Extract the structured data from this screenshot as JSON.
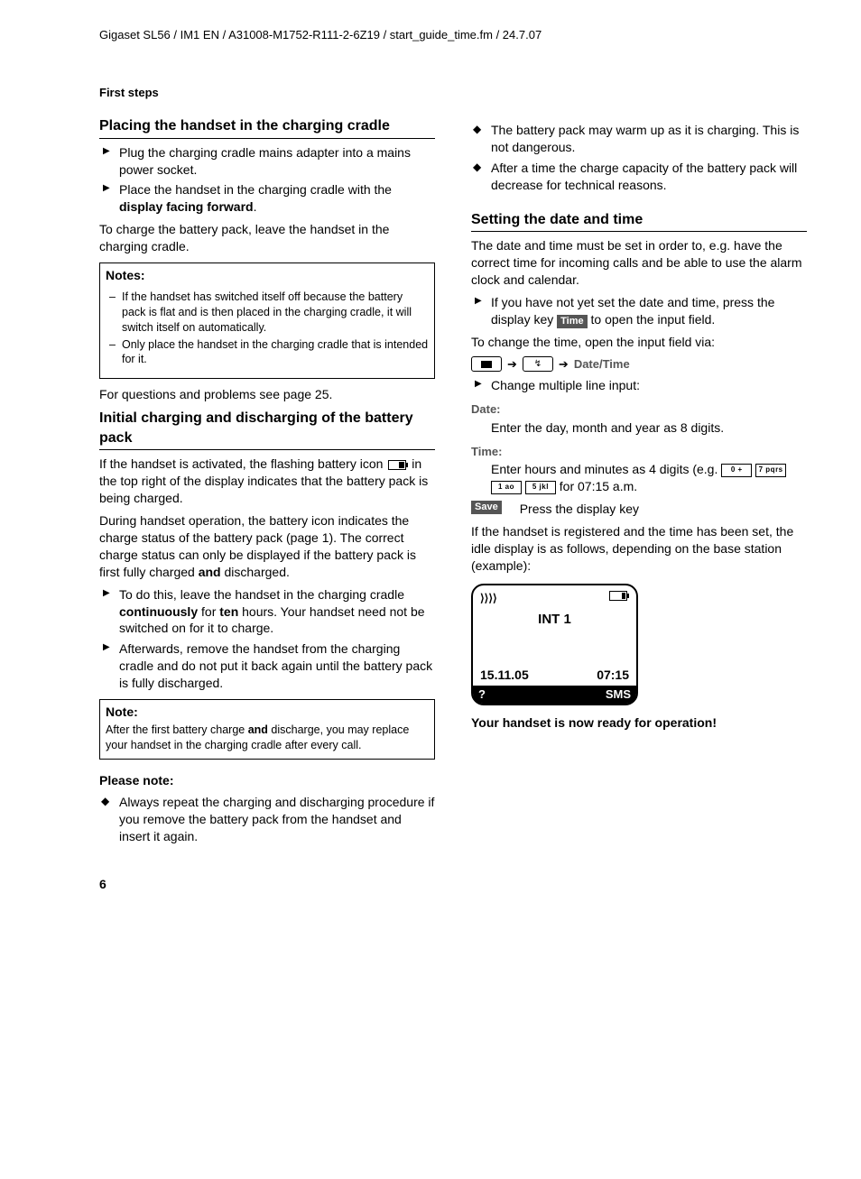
{
  "header_path": "Gigaset SL56 / IM1 EN / A31008-M1752-R111-2-6Z19 / start_guide_time.fm / 24.7.07",
  "section_label": "First steps",
  "page_number": "6",
  "left": {
    "h_placing": "Placing the handset in the charging cradle",
    "placing_items": [
      "Plug the charging cradle mains adapter into a mains power socket.",
      "Place the handset in the charging cradle with the "
    ],
    "placing_item2_bold": "display facing forward",
    "placing_item2_tail": ".",
    "charge_para": "To charge the battery pack, leave the handset in the charging cradle.",
    "notes_title": "Notes:",
    "notes_items": [
      "If the handset has switched itself off because the battery pack is flat and is then placed in the charging cradle, it will switch itself on automatically.",
      "Only place the handset in the charging cradle that is intended for it."
    ],
    "questions": "For questions and problems see page 25.",
    "h_initial": "Initial charging and discharging of the battery pack",
    "init_p1a": "If the handset is activated, the flashing battery icon ",
    "init_p1b": " in the top right of the display indicates that the battery pack is being charged.",
    "init_p2a": "During handset operation, the battery icon indicates the charge status of the battery pack (page 1). The correct charge status can only be displayed if the battery pack is first fully charged ",
    "init_p2_bold": "and",
    "init_p2b": " discharged.",
    "init_li1a": "To do this, leave the handset in the charging cradle ",
    "init_li1_b1": "continuously",
    "init_li1_mid": " for ",
    "init_li1_b2": "ten",
    "init_li1b": " hours. Your handset need not be switched on for it to charge.",
    "init_li2": "Afterwards, remove the handset from the charging cradle and do not put it back again until the battery pack is fully discharged.",
    "note2_title": "Note:",
    "note2_a": "After the first battery charge ",
    "note2_bold": "and",
    "note2_b": " discharge, you may replace your handset in the charging cradle after every call.",
    "please_note": "Please note:",
    "please_items": [
      "Always repeat the charging and discharging procedure if you remove the battery pack from the handset and insert it again."
    ]
  },
  "right": {
    "top_items": [
      "The battery pack may warm up as it is charging. This is not dangerous.",
      "After a time the charge capacity of the battery pack will decrease for technical reasons."
    ],
    "h_setting": "Setting the date and time",
    "set_p1": "The date and time must be set in order to, e.g. have the correct time for incoming calls and be able to use the alarm clock and calendar.",
    "set_li1a": "If you have not yet set the date and time, press the display key ",
    "time_key": "Time",
    "set_li1b": " to open the input field.",
    "set_p2": "To change the time, open the input field via:",
    "breadcrumb_end": "Date/Time",
    "change_li": "Change multiple line input:",
    "date_label": "Date:",
    "date_desc": "Enter the day, month and year as 8 digits.",
    "time_label": "Time:",
    "time_desc_a": "Enter hours and minutes as 4 digits (e.g. ",
    "keycaps": [
      "0 +",
      "7 pqrs",
      "1 ao",
      "5 jkl"
    ],
    "time_desc_b": " for 07:15 a.m.",
    "save_key": "Save",
    "save_desc": "Press the display key",
    "after_p": "If the handset is registered and the time has been set, the idle display is as follows, depending on the base station (example):",
    "screen": {
      "signal": "⟩⟩⟩⟩",
      "title": "INT 1",
      "date": "15.11.05",
      "time": "07:15",
      "soft_left": "?",
      "soft_right": "SMS"
    },
    "ready": "Your handset is now ready for operation!"
  }
}
